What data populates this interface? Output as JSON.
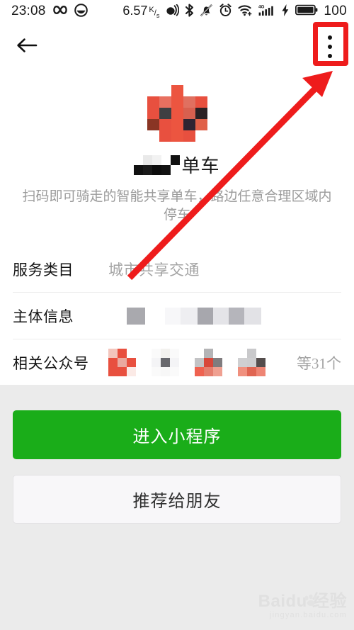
{
  "status_bar": {
    "time": "23:08",
    "icons_left": [
      "infinity-icon",
      "emoji-face-icon"
    ],
    "network_speed": "6.57",
    "network_speed_unit_num": "K",
    "network_speed_unit_den": "s",
    "icons_right": [
      "location-radar-icon",
      "bluetooth-icon",
      "mute-bell-icon",
      "alarm-clock-icon",
      "wifi-plus-icon",
      "signal-4g-icon",
      "charging-bolt-icon",
      "battery-icon"
    ],
    "battery_level": "100",
    "signal_label": "4G"
  },
  "nav": {
    "back_icon": "back-arrow-icon",
    "more_icon": "more-vertical-icon"
  },
  "annotation": {
    "box_color": "#ee1c1c",
    "arrow_color": "#ee1c1c",
    "target": "more-vertical-icon"
  },
  "profile": {
    "logo_alt": "pixelated-app-logo",
    "title_masked_prefix": "███",
    "title_text": "单车",
    "description": "扫码即可骑走的智能共享单车，路边任意合理区域内停车"
  },
  "info_rows": [
    {
      "label": "服务类目",
      "value": "城市共享交通",
      "masked": false
    },
    {
      "label": "主体信息",
      "value": "",
      "masked": true
    },
    {
      "label": "相关公众号",
      "value": "",
      "masked": true,
      "more_text": "等31个",
      "avatar_count": 4
    }
  ],
  "actions": {
    "primary_label": "进入小程序",
    "primary_color": "#1aad19",
    "secondary_label": "推荐给朋友"
  },
  "watermark": {
    "main": "Baidu 经验",
    "sub": "jingyan.baidu.com"
  }
}
